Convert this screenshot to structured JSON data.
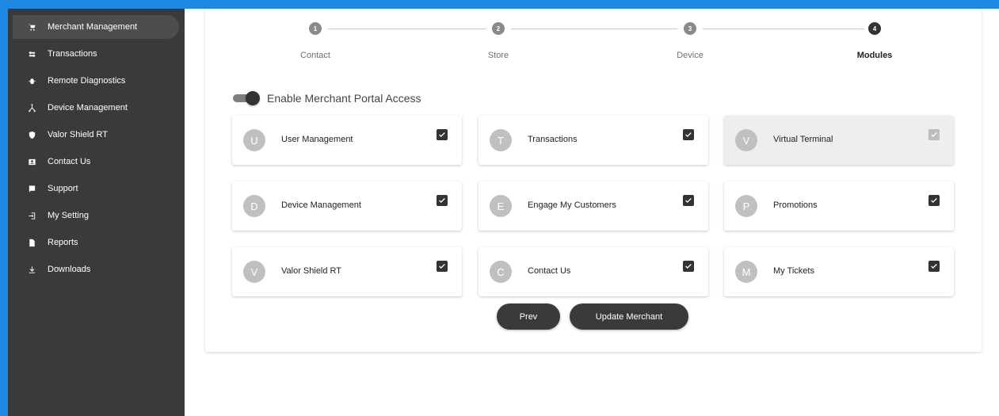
{
  "sidebar": {
    "items": [
      {
        "label": "Merchant Management",
        "icon": "cart-icon",
        "active": true
      },
      {
        "label": "Transactions",
        "icon": "swap-icon"
      },
      {
        "label": "Remote Diagnostics",
        "icon": "bug-icon"
      },
      {
        "label": "Device Management",
        "icon": "device-hub-icon"
      },
      {
        "label": "Valor Shield RT",
        "icon": "shield-icon"
      },
      {
        "label": "Contact Us",
        "icon": "contact-icon"
      },
      {
        "label": "Support",
        "icon": "support-icon"
      },
      {
        "label": "My Setting",
        "icon": "settings-icon"
      },
      {
        "label": "Reports",
        "icon": "report-icon"
      },
      {
        "label": "Downloads",
        "icon": "download-icon"
      }
    ]
  },
  "stepper": {
    "steps": [
      {
        "number": "1",
        "label": "Contact"
      },
      {
        "number": "2",
        "label": "Store"
      },
      {
        "number": "3",
        "label": "Device"
      },
      {
        "number": "4",
        "label": "Modules"
      }
    ],
    "active_step": 4
  },
  "portal_toggle": {
    "label": "Enable Merchant Portal Access",
    "enabled": true
  },
  "modules": [
    {
      "initial": "U",
      "label": "User Management",
      "checked": true,
      "disabled": false
    },
    {
      "initial": "T",
      "label": "Transactions",
      "checked": true,
      "disabled": false
    },
    {
      "initial": "V",
      "label": "Virtual Terminal",
      "checked": true,
      "disabled": true
    },
    {
      "initial": "D",
      "label": "Device Management",
      "checked": true,
      "disabled": false
    },
    {
      "initial": "E",
      "label": "Engage My Customers",
      "checked": true,
      "disabled": false
    },
    {
      "initial": "P",
      "label": "Promotions",
      "checked": true,
      "disabled": false
    },
    {
      "initial": "V",
      "label": "Valor Shield RT",
      "checked": true,
      "disabled": false
    },
    {
      "initial": "C",
      "label": "Contact Us",
      "checked": true,
      "disabled": false
    },
    {
      "initial": "M",
      "label": "My Tickets",
      "checked": true,
      "disabled": false
    }
  ],
  "buttons": {
    "prev": "Prev",
    "update": "Update Merchant"
  },
  "colors": {
    "accent_frame": "#1e88e5",
    "sidebar_bg": "#3a3a3a",
    "primary_dark": "#333333"
  }
}
